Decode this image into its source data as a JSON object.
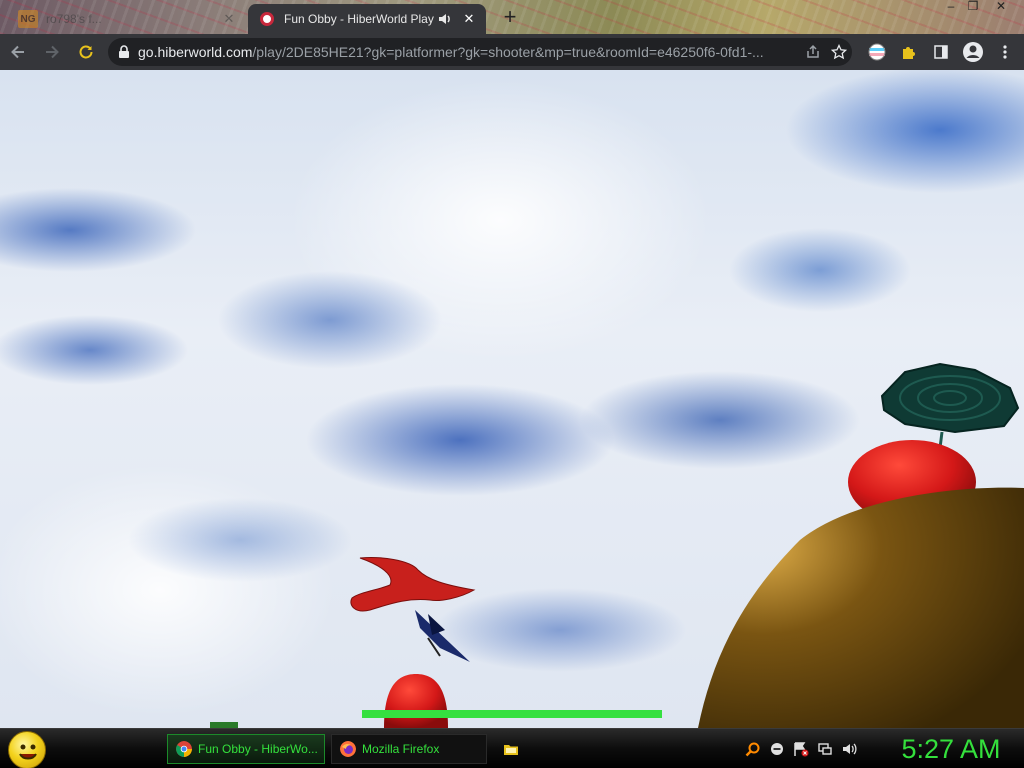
{
  "browser": {
    "tabs": [
      {
        "title": "ro798's f...",
        "active": false,
        "favicon": "newgrounds-icon",
        "favicon_text": "NG"
      },
      {
        "title": "Fun Obby - HiberWorld Play",
        "active": true,
        "favicon": "hiberworld-icon"
      }
    ],
    "url": {
      "host": "go.hiberworld.com",
      "path": "/play/2DE85HE21?gk=platformer?gk=shooter&mp=true&roomId=e46250f6-0fd1-..."
    }
  },
  "game": {
    "health_fraction": 1.0,
    "colors": {
      "health": "#35e040",
      "sky": "#dfe6f1",
      "bird": "#c8201c",
      "balloon": "#d41818",
      "mound": "#6a4a12"
    }
  },
  "taskbar": {
    "tasks": [
      {
        "label": "Fun Obby - HiberWo...",
        "icon": "chrome-icon",
        "active": true
      },
      {
        "label": "Mozilla Firefox",
        "icon": "firefox-icon",
        "active": false
      }
    ],
    "clock": "5:27 AM",
    "accent": "#34e03c"
  }
}
